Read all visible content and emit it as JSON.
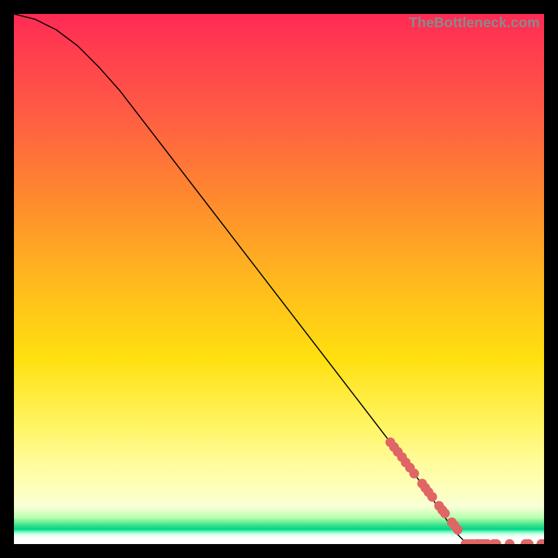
{
  "watermark": "TheBottleneck.com",
  "colors": {
    "curve": "#000000",
    "dot": "#e06666"
  },
  "chart_data": {
    "type": "line",
    "title": "",
    "xlabel": "",
    "ylabel": "",
    "xlim": [
      0,
      100
    ],
    "ylim": [
      0,
      100
    ],
    "curve": {
      "x": [
        0,
        4,
        8,
        12,
        16,
        20,
        25,
        30,
        35,
        40,
        45,
        50,
        55,
        60,
        65,
        70,
        75,
        80,
        83,
        85,
        87
      ],
      "y": [
        100,
        99,
        97,
        94,
        90,
        85.5,
        79,
        72.5,
        66,
        59.5,
        53,
        46.5,
        40,
        33.5,
        27,
        20.5,
        14,
        7,
        2.5,
        0.5,
        0
      ]
    },
    "scatter_on_curve": {
      "x": [
        71.0,
        71.7,
        72.4,
        73.2,
        73.9,
        74.7,
        75.5,
        77.0,
        77.6,
        78.2,
        78.9,
        80.2,
        80.8,
        81.3,
        82.6,
        83.1,
        83.7
      ],
      "y": [
        19.2,
        18.3,
        17.4,
        16.4,
        15.4,
        14.4,
        13.3,
        11.4,
        10.6,
        9.8,
        8.9,
        7.2,
        6.4,
        5.8,
        4.1,
        3.5,
        2.7
      ]
    },
    "scatter_bottom": {
      "x": [
        85.2,
        85.9,
        86.5,
        87.2,
        87.7,
        88.2,
        88.8,
        89.3,
        90.5,
        91.0,
        93.5,
        96.5,
        97.1,
        99.5,
        100.0
      ],
      "y": [
        0,
        0,
        0,
        0,
        0,
        0,
        0,
        0,
        0,
        0,
        0,
        0,
        0,
        0,
        0
      ]
    }
  }
}
